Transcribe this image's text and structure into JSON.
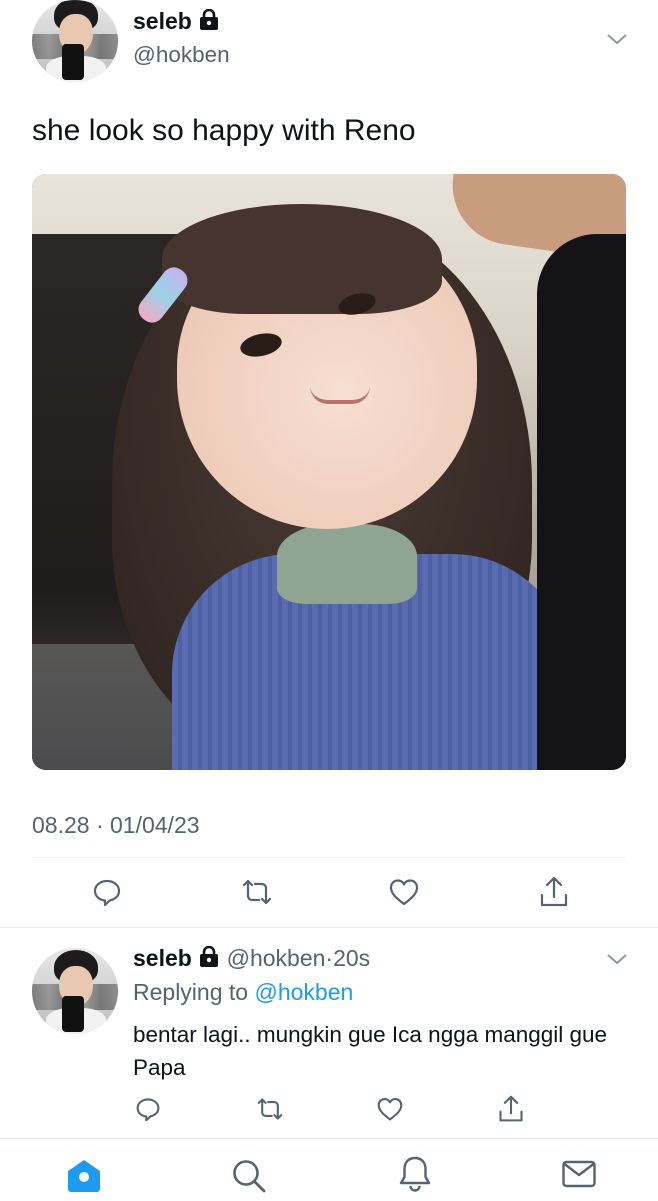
{
  "tweet": {
    "author_name": "seleb",
    "author_handle": "@hokben",
    "text": "she look so happy with Reno",
    "timestamp": "08.28 · 01/04/23",
    "icons": {
      "lock": "lock-icon",
      "menu": "chevron-down-icon",
      "photo": "tweet-photo"
    },
    "actions": [
      {
        "name": "reply",
        "icon": "reply-icon"
      },
      {
        "name": "retweet",
        "icon": "retweet-icon"
      },
      {
        "name": "like",
        "icon": "heart-icon"
      },
      {
        "name": "share",
        "icon": "share-icon"
      }
    ]
  },
  "reply": {
    "author_name": "seleb",
    "author_handle": "@hokben",
    "separator": "·",
    "time_ago": "20s",
    "replying_prefix": "Replying to",
    "replying_handle": "@hokben",
    "text": "bentar lagi.. mungkin gue Ica ngga manggil gue Papa"
  },
  "tabbar": {
    "items": [
      {
        "name": "home",
        "icon": "home-icon",
        "active": true
      },
      {
        "name": "search",
        "icon": "search-icon",
        "active": false
      },
      {
        "name": "notifications",
        "icon": "bell-icon",
        "active": false
      },
      {
        "name": "messages",
        "icon": "mail-icon",
        "active": false
      }
    ]
  },
  "colors": {
    "accent": "#1d9bf0",
    "text": "#0f1419",
    "secondary": "#536471",
    "divider": "#eff3f4"
  }
}
